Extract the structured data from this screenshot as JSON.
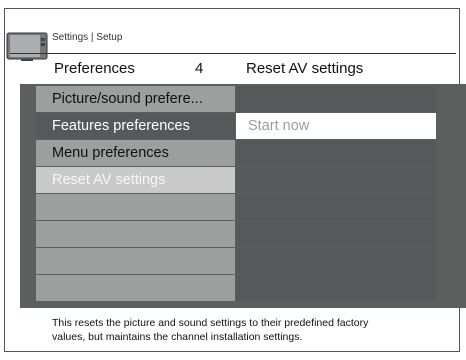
{
  "breadcrumb": "Settings | Setup",
  "header": {
    "left_title": "Preferences",
    "count": "4",
    "right_title": "Reset AV settings"
  },
  "menu": {
    "items": [
      {
        "label": "Picture/sound prefere..."
      },
      {
        "label": "Features preferences"
      },
      {
        "label": "Menu preferences"
      },
      {
        "label": "Reset AV settings"
      },
      {
        "label": ""
      },
      {
        "label": ""
      },
      {
        "label": ""
      },
      {
        "label": ""
      }
    ]
  },
  "submenu": {
    "items": [
      {
        "label": ""
      },
      {
        "label": "Start now"
      },
      {
        "label": ""
      },
      {
        "label": ""
      },
      {
        "label": ""
      },
      {
        "label": ""
      },
      {
        "label": ""
      },
      {
        "label": ""
      }
    ]
  },
  "description": {
    "line1": "This resets the picture and sound settings to their predefined factory",
    "line2": "values, but maintains the channel installation settings."
  },
  "icons": {
    "tv": "tv-icon"
  },
  "colors": {
    "panel": "#5b5f5e",
    "menu_row": "#9d9f9e",
    "menu_row_dark": "#55595a",
    "menu_row_selected": "#c8c9c8",
    "submenu_row": "#55595a",
    "submenu_highlight": "#ffffff"
  }
}
